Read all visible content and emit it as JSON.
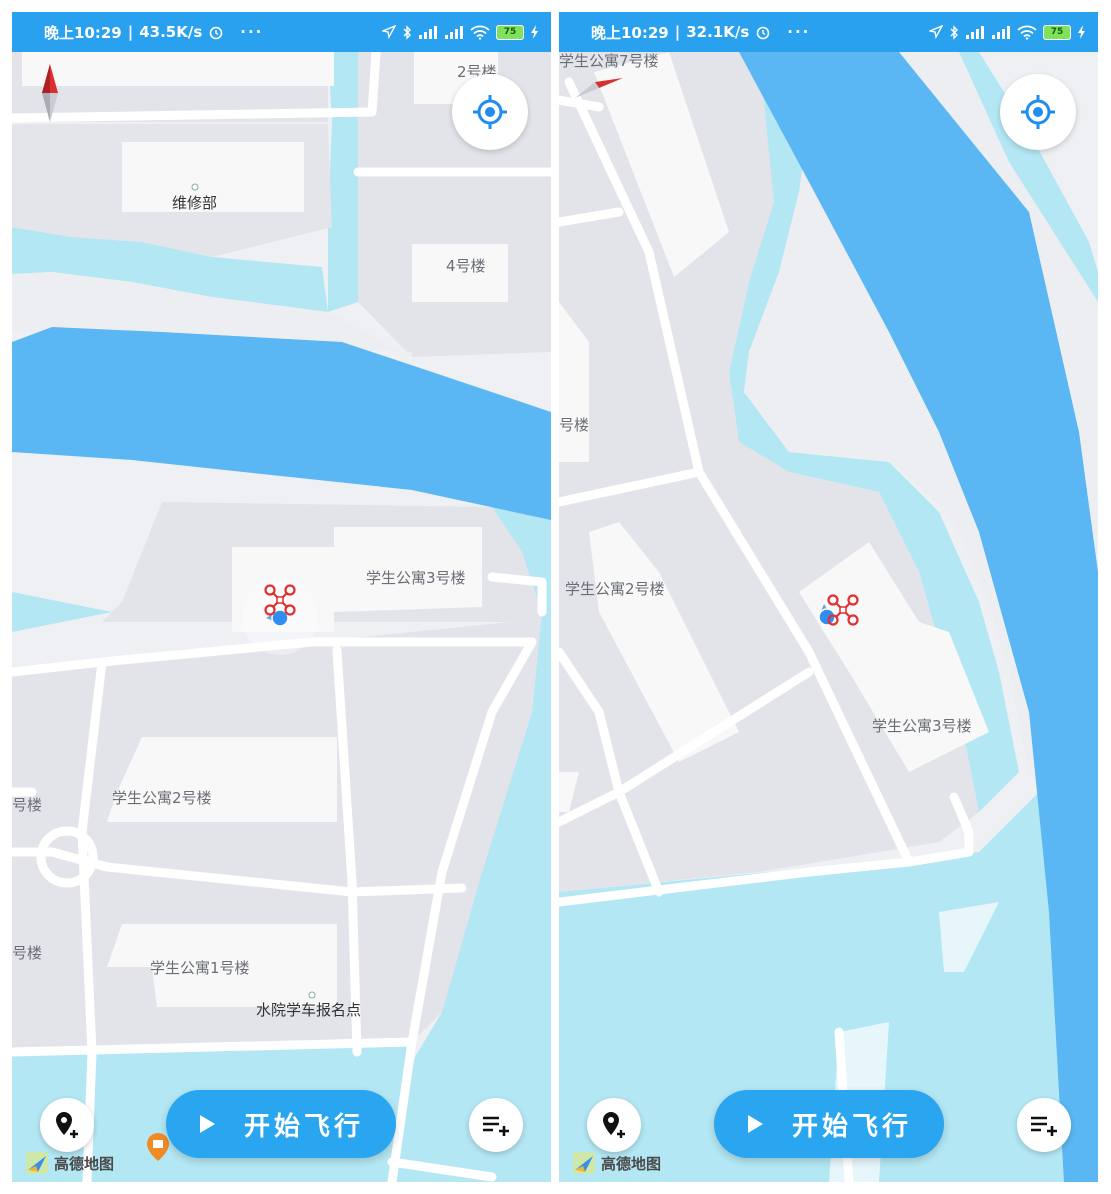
{
  "colors": {
    "statusbar": "#2aa1ee",
    "river": "#5ab7f3",
    "lake": "#b3e7f3",
    "land": "#eef0f4",
    "block": "#e2e4e9",
    "building": "#f8f8f9",
    "road": "#ffffff",
    "accent": "#2aa5f0",
    "drone": "#e03030"
  },
  "left": {
    "status": {
      "time": "晚上10:29",
      "speed": "43.5K/s",
      "dots": "···",
      "battery": "75"
    },
    "labels": {
      "bldg2": "2号楼",
      "repair": "维修部",
      "bldg4": "4号楼",
      "dorm3": "学生公寓3号楼",
      "dorm2": "学生公寓2号楼",
      "dorm1": "学生公寓1号楼",
      "school": "水院学车报名点",
      "edge1": "号楼",
      "edge2": "号楼"
    },
    "start_label": "开始飞行",
    "logo_text": "高德地图"
  },
  "right": {
    "status": {
      "time": "晚上10:29",
      "speed": "32.1K/s",
      "dots": "···",
      "battery": "75"
    },
    "labels": {
      "dorm7": "学生公寓7号楼",
      "edge": "号楼",
      "dorm2": "学生公寓2号楼",
      "dorm3": "学生公寓3号楼"
    },
    "start_label": "开始飞行",
    "logo_text": "高德地图"
  },
  "icons": {
    "compass": "compass-needle-icon",
    "locate": "locate-crosshair-icon",
    "add_waypoint": "map-pin-plus-icon",
    "waypoint_list": "list-add-icon",
    "play": "play-icon",
    "drone": "drone-icon",
    "location": "location-dot-icon",
    "logo": "amap-logo-icon"
  }
}
